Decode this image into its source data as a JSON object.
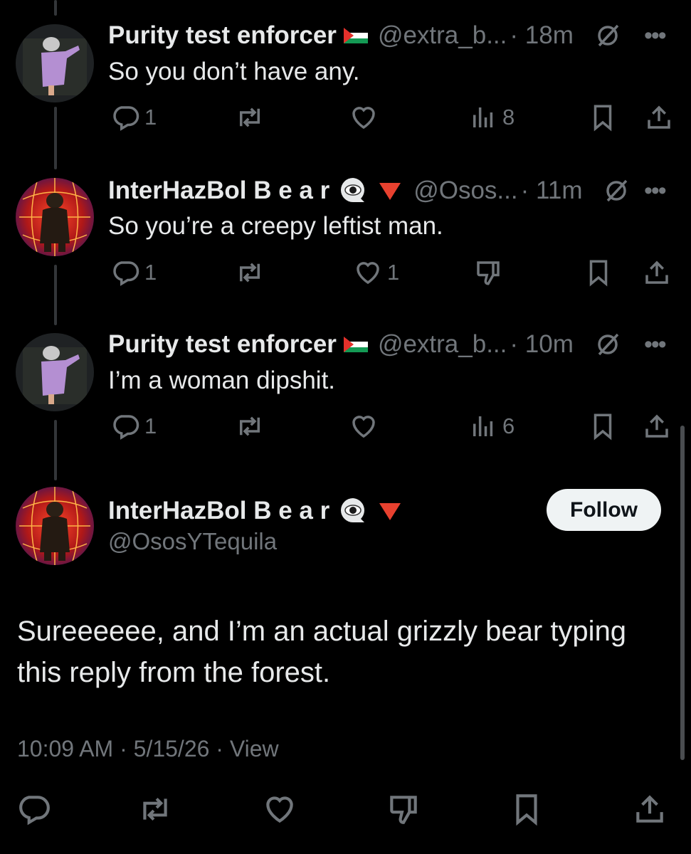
{
  "replies": [
    {
      "name": "Purity test enforcer",
      "handle": "@extra_b...",
      "time": "· 18m",
      "text": "So you don’t have any.",
      "comments": "1",
      "likes": "",
      "views": "8"
    },
    {
      "name": "InterHazBol B e a r",
      "handle": "@Osos...",
      "time": "· 11m",
      "text": "So you’re a creepy leftist man.",
      "comments": "1",
      "likes": "1",
      "views": ""
    },
    {
      "name": "Purity test enforcer",
      "handle": "@extra_b...",
      "time": "· 10m",
      "text": "I’m a woman dipshit.",
      "comments": "1",
      "likes": "",
      "views": "6"
    }
  ],
  "main_post": {
    "name": "InterHazBol B e a r",
    "handle": "@OsosYTequila",
    "follow_label": "Follow",
    "text": "Sureeeeee, and I’m an actual grizzly bear typing this reply from the forest.",
    "timestamp": "10:09 AM · 5/15/26 · View"
  },
  "colors": {
    "background": "#000000",
    "text": "#e7e9ea",
    "muted": "#71767b",
    "follow_bg": "#eff3f4"
  }
}
